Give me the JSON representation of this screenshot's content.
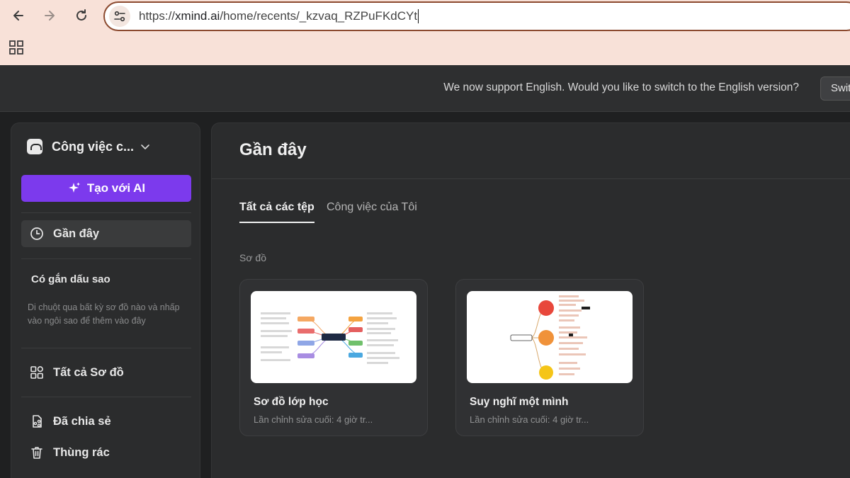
{
  "browser": {
    "url_host_prefix": "https://",
    "url_host": "xmind.ai",
    "url_path": "/home/recents/_kzvaq_RZPuFKdCYt",
    "icons": [
      "back-arrow-icon",
      "forward-arrow-icon",
      "reload-icon",
      "site-settings-icon",
      "apps-grid-icon"
    ]
  },
  "banner": {
    "text": "We now support English. Would you like to switch to the English version?",
    "switch_label": "Switch"
  },
  "sidebar": {
    "workspace_name": "Công việc c...",
    "ai_button": "Tạo với AI",
    "recent": "Gần đây",
    "starred_title": "Có gắn dấu sao",
    "starred_hint": "Di chuột qua bất kỳ sơ đồ nào và nhấp vào ngôi sao để thêm vào đây",
    "all_maps": "Tất cả Sơ đồ",
    "shared": "Đã chia sẻ",
    "trash": "Thùng rác"
  },
  "main": {
    "title": "Gần đây",
    "tabs": [
      {
        "label": "Tất cả các tệp",
        "active": true
      },
      {
        "label": "Công việc của Tôi",
        "active": false
      }
    ],
    "section_label": "Sơ đồ",
    "cards": [
      {
        "title": "Sơ đồ lớp học",
        "subtitle": "Lần chỉnh sửa cuối: 4 giờ tr..."
      },
      {
        "title": "Suy nghĩ một mình",
        "subtitle": "Lần chỉnh sửa cuối: 4 giờ tr..."
      }
    ]
  },
  "colors": {
    "accent": "#7c3aed",
    "chrome_bg": "#f8e1d8",
    "app_bg": "#1f2021",
    "panel_bg": "#2b2c2d"
  }
}
